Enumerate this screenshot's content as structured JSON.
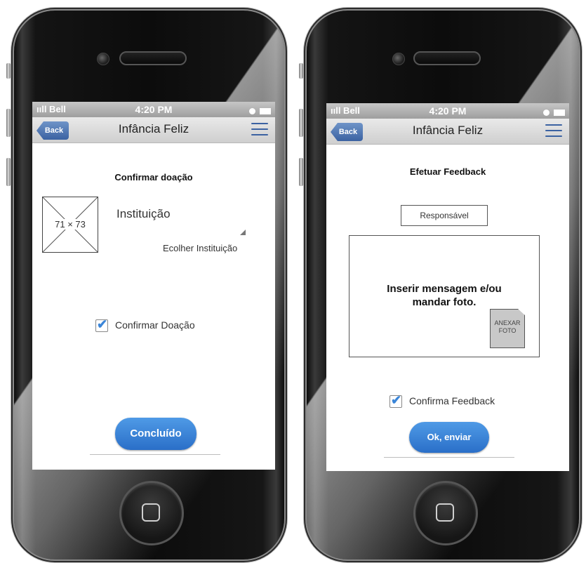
{
  "status_bar": {
    "carrier": "ııll Bell",
    "time": "4:20 PM"
  },
  "nav": {
    "back_label": "Back",
    "title": "Infância Feliz"
  },
  "left_screen": {
    "title": "Confirmar doação",
    "image_placeholder": "71 × 73",
    "field_label": "Instituição",
    "select_value": "Ecolher Instituição",
    "checkbox_label": "Confirmar Doação",
    "button_label": "Concluído"
  },
  "right_screen": {
    "title": "Efetuar Feedback",
    "responsavel_label": "Responsável",
    "message_placeholder": "Inserir mensagem e/ou mandar foto.",
    "attach_label": "ANEXAR FOTO",
    "checkbox_label": "Confirma Feedback",
    "button_label": "Ok, enviar"
  },
  "colors": {
    "accent_blue": "#2a6fc8",
    "nav_blue": "#3b62a2"
  }
}
